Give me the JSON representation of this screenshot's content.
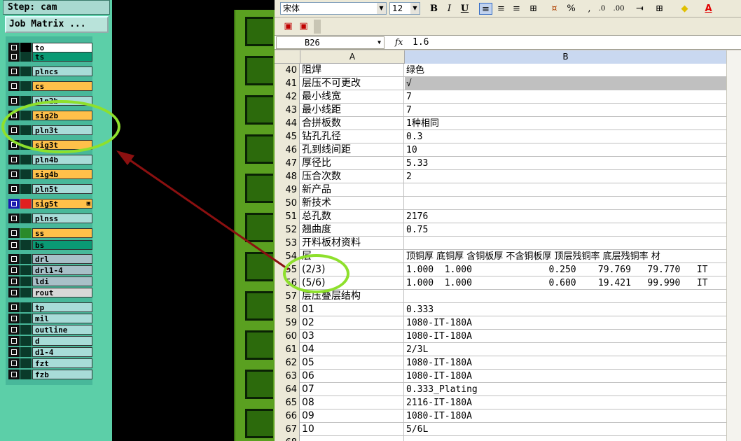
{
  "genesis": {
    "step_label": "Step: cam",
    "job_matrix_label": "Job Matrix ...",
    "layers": [
      {
        "name": "to",
        "color": "#ffffff",
        "swatch": "#000000",
        "checked": false
      },
      {
        "name": "ts",
        "color": "#0a9a74",
        "swatch": "#0a3a2a",
        "checked": false
      },
      {
        "name": "plncs",
        "color": "#a8dcd8",
        "swatch": "#0a3a2a",
        "checked": false
      },
      {
        "name": "cs",
        "color": "#ffc04a",
        "swatch": "#0a3a2a",
        "checked": false
      },
      {
        "name": "pln2b",
        "color": "#a8dcd8",
        "swatch": "#0a3a2a",
        "checked": false
      },
      {
        "name": "sig2b",
        "color": "#ffc04a",
        "swatch": "#0a3a2a",
        "checked": false
      },
      {
        "name": "pln3t",
        "color": "#a8dcd8",
        "swatch": "#0a3a2a",
        "checked": false
      },
      {
        "name": "sig3t",
        "color": "#ffc04a",
        "swatch": "#0a3a2a",
        "checked": false
      },
      {
        "name": "pln4b",
        "color": "#a8dcd8",
        "swatch": "#0a3a2a",
        "checked": false
      },
      {
        "name": "sig4b",
        "color": "#ffc04a",
        "swatch": "#0a3a2a",
        "checked": false
      },
      {
        "name": "pln5t",
        "color": "#a8dcd8",
        "swatch": "#0a3a2a",
        "checked": false
      },
      {
        "name": "sig5t",
        "color": "#ffc04a",
        "swatch": "#e02020",
        "checked": true
      },
      {
        "name": "plnss",
        "color": "#a8dcd8",
        "swatch": "#0a3a2a",
        "checked": false
      },
      {
        "name": "ss",
        "color": "#ffc04a",
        "swatch": "#2a8a2a",
        "checked": false
      },
      {
        "name": "bs",
        "color": "#0a9a74",
        "swatch": "#0a3a2a",
        "checked": false
      },
      {
        "name": "drl",
        "color": "#a8c0c8",
        "swatch": "#0a3a2a",
        "checked": false
      },
      {
        "name": "drl1-4",
        "color": "#a8c0c8",
        "swatch": "#0a3a2a",
        "checked": false
      },
      {
        "name": "ldi",
        "color": "#a8c0c8",
        "swatch": "#0a3a2a",
        "checked": false
      },
      {
        "name": "rout",
        "color": "#d8d8d8",
        "swatch": "#0a3a2a",
        "checked": false
      },
      {
        "name": "tp",
        "color": "#a8dcd8",
        "swatch": "#0a3a2a",
        "checked": false
      },
      {
        "name": "mil",
        "color": "#a8dcd8",
        "swatch": "#0a3a2a",
        "checked": false
      },
      {
        "name": "outline",
        "color": "#a8dcd8",
        "swatch": "#0a3a2a",
        "checked": false
      },
      {
        "name": "d",
        "color": "#a8dcd8",
        "swatch": "#0a3a2a",
        "checked": false
      },
      {
        "name": "d1-4",
        "color": "#a8dcd8",
        "swatch": "#0a3a2a",
        "checked": false
      },
      {
        "name": "fzt",
        "color": "#a8dcd8",
        "swatch": "#0a3a2a",
        "checked": false
      },
      {
        "name": "fzb",
        "color": "#a8dcd8",
        "swatch": "#0a3a2a",
        "checked": false
      }
    ]
  },
  "excel": {
    "font_name": "宋体",
    "font_size": "12",
    "cell_ref": "B26",
    "fx_label": "fx",
    "formula_value": "1.6",
    "toolbar": {
      "bold": "B",
      "italic": "I",
      "underline": "U",
      "percent": "%",
      "comma": ",",
      "inc_dec": ".0",
      "dec_dec": ".00",
      "font_color": "A"
    },
    "col_a": "A",
    "col_b": "B",
    "rows": [
      {
        "n": "40",
        "a": "阻焊",
        "b": "绿色"
      },
      {
        "n": "41",
        "a": "层压不可更改",
        "b": "√"
      },
      {
        "n": "42",
        "a": "最小线宽",
        "b": "7"
      },
      {
        "n": "43",
        "a": "最小线距",
        "b": "7"
      },
      {
        "n": "44",
        "a": "合拼板数",
        "b": "1种相同"
      },
      {
        "n": "45",
        "a": "钻孔孔径",
        "b": "0.3"
      },
      {
        "n": "46",
        "a": "孔到线间距",
        "b": "10"
      },
      {
        "n": "47",
        "a": "厚径比",
        "b": "5.33"
      },
      {
        "n": "48",
        "a": "压合次数",
        "b": "2"
      },
      {
        "n": "49",
        "a": "新产品",
        "b": ""
      },
      {
        "n": "50",
        "a": "新技术",
        "b": ""
      },
      {
        "n": "51",
        "a": "总孔数",
        "b": "2176"
      },
      {
        "n": "52",
        "a": "翘曲度",
        "b": "0.75"
      },
      {
        "n": "53",
        "a": "开料板材资料",
        "b": ""
      },
      {
        "n": "54",
        "a": "层",
        "b": "顶铜厚 底铜厚 含铜板厚 不含铜板厚 顶层残铜率 底层残铜率 材"
      },
      {
        "n": "55",
        "a": "(2/3)",
        "b": "1.000  1.000              0.250    79.769   79.770   IT"
      },
      {
        "n": "56",
        "a": "(5/6)",
        "b": "1.000  1.000              0.600    19.421   99.990   IT"
      },
      {
        "n": "57",
        "a": "层压叠层结构",
        "b": ""
      },
      {
        "n": "58",
        "a": "01",
        "b": "0.333"
      },
      {
        "n": "59",
        "a": "02",
        "b": "1080-IT-180A"
      },
      {
        "n": "60",
        "a": "03",
        "b": "1080-IT-180A"
      },
      {
        "n": "61",
        "a": "04",
        "b": "2/3L"
      },
      {
        "n": "62",
        "a": "05",
        "b": "1080-IT-180A"
      },
      {
        "n": "63",
        "a": "06",
        "b": "1080-IT-180A"
      },
      {
        "n": "64",
        "a": "07",
        "b": "0.333_Plating"
      },
      {
        "n": "65",
        "a": "08",
        "b": "2116-IT-180A"
      },
      {
        "n": "66",
        "a": "09",
        "b": "1080-IT-180A"
      },
      {
        "n": "67",
        "a": "10",
        "b": "5/6L"
      },
      {
        "n": "68",
        "a": "",
        "b": ""
      }
    ]
  }
}
